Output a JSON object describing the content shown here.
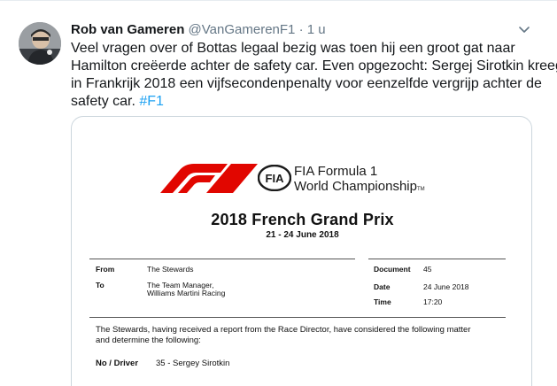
{
  "tweet": {
    "author_name": "Rob van Gameren",
    "handle": "@VanGamerenF1",
    "separator": "·",
    "time": "1 u",
    "text_lines": [
      "Veel vragen over of Bottas legaal bezig was toen hij een groot gat naar",
      "Hamilton creëerde achter de safety car. Even opgezocht: Sergej Sirotkin kreeg",
      "in Frankrijk 2018 een vijfsecondenpenalty voor eenzelfde vergrijp achter de"
    ],
    "last_line_text": "safety car. ",
    "hashtag": "#F1"
  },
  "document": {
    "logo_line1": "FIA Formula 1",
    "logo_line2": "World Championship",
    "logo_tm": "TM",
    "fia_badge": "FIA",
    "title": "2018 French Grand Prix",
    "dates": "21 - 24 June 2018",
    "from_label": "From",
    "from_value": "The Stewards",
    "to_label": "To",
    "to_value_line1": "The Team Manager,",
    "to_value_line2": "Williams Martini Racing",
    "document_label": "Document",
    "document_value": "45",
    "date_label": "Date",
    "date_value": "24 June 2018",
    "time_label": "Time",
    "time_value": "17:20",
    "body_line1": "The Stewards, having received a report from the Race Director, have considered the following matter",
    "body_line2": "and determine the following:",
    "driver_label": "No / Driver",
    "driver_value": "35 - Sergey Sirotkin"
  },
  "colors": {
    "f1_red": "#e10600",
    "link_blue": "#1da1f2",
    "muted_gray": "#657786"
  },
  "icons": {
    "menu": "chevron-down-icon",
    "avatar": "avatar"
  }
}
